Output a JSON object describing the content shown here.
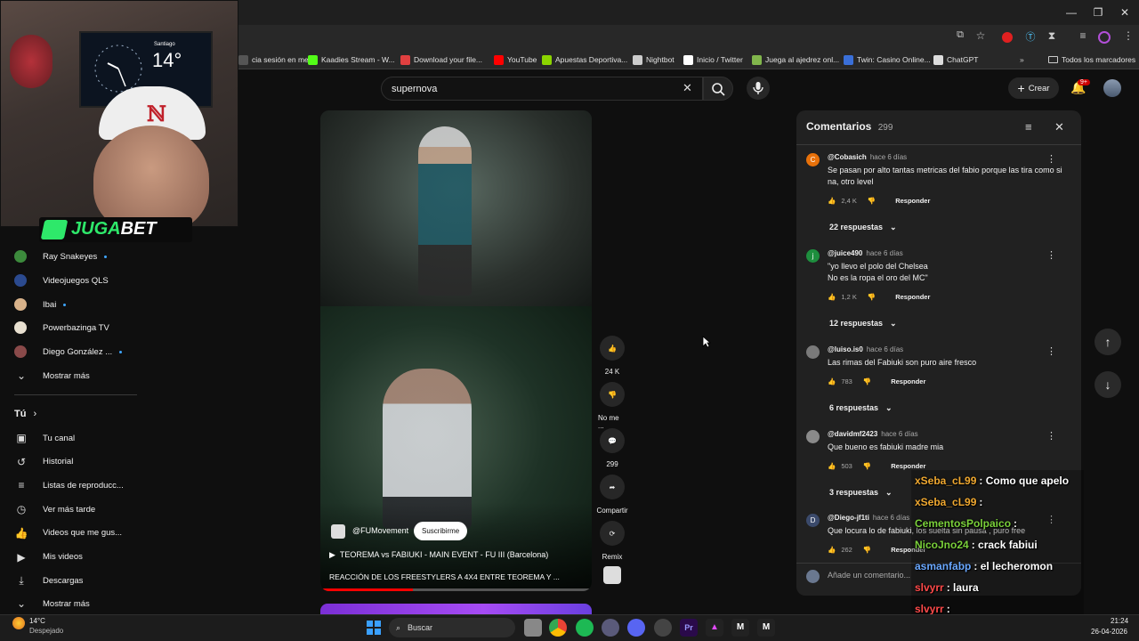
{
  "bookmarks": [
    {
      "label": "cia sesión en me...",
      "color": "#555555"
    },
    {
      "label": "Kaadies Stream - W...",
      "color": "#53fc18"
    },
    {
      "label": "Download your file...",
      "color": "#e04040"
    },
    {
      "label": "YouTube",
      "color": "#ff0000"
    },
    {
      "label": "Apuestas Deportiva...",
      "color": "#8bd400"
    },
    {
      "label": "Nightbot",
      "color": "#cccccc"
    },
    {
      "label": "Inicio / Twitter",
      "color": "#ffffff"
    },
    {
      "label": "Juega al ajedrez onl...",
      "color": "#81b64c"
    },
    {
      "label": "Twin: Casino Online...",
      "color": "#3a6fd8"
    },
    {
      "label": "ChatGPT",
      "color": "#dddddd"
    }
  ],
  "bookmarks_all": "Todos los marcadores",
  "bookmarks_more": "»",
  "search": {
    "value": "supernova"
  },
  "crear": "Crear",
  "notif_badge": "9+",
  "webcam": {
    "city": "Santiago",
    "temp": "14°"
  },
  "jugabet": {
    "juga": "JUGA",
    "bet": "BET"
  },
  "sidebar": {
    "channels": [
      {
        "label": "Ray Snakeyes",
        "color": "#3c8a3c",
        "dot": true
      },
      {
        "label": "Videojuegos QLS",
        "color": "#2b4a8f",
        "dot": false
      },
      {
        "label": "Ibai",
        "color": "#d8b28a",
        "dot": true
      },
      {
        "label": "Powerbazinga TV",
        "color": "#e8e0d0",
        "dot": false
      },
      {
        "label": "Diego González ...",
        "color": "#8a4a4a",
        "dot": true
      }
    ],
    "show_more": "Mostrar más",
    "tu_header": "Tú",
    "tu_items": [
      {
        "label": "Tu canal",
        "icon": "channel-icon",
        "glyph": "▣"
      },
      {
        "label": "Historial",
        "icon": "history-icon",
        "glyph": "↺"
      },
      {
        "label": "Listas de reproducc...",
        "icon": "playlists-icon",
        "glyph": "≡"
      },
      {
        "label": "Ver más tarde",
        "icon": "clock-icon",
        "glyph": "◷"
      },
      {
        "label": "Videos que me gus...",
        "icon": "like-icon",
        "glyph": "👍"
      },
      {
        "label": "Mis videos",
        "icon": "my-videos-icon",
        "glyph": "▶"
      },
      {
        "label": "Descargas",
        "icon": "download-icon",
        "glyph": "⤓"
      }
    ],
    "show_more_2": "Mostrar más"
  },
  "video": {
    "channel": "@FUMovement",
    "subscribe": "Suscribirme",
    "related_title": "TEOREMA vs FABIUKI - MAIN EVENT - FU III (Barcelona)",
    "title": "REACCIÓN DE LOS FREESTYLERS A 4X4 ENTRE TEOREMA Y ...",
    "progress": 0.34
  },
  "actions": {
    "likes": "24 K",
    "dislike": "No me ...",
    "comments": "299",
    "share": "Compartir",
    "remix": "Remix"
  },
  "comments": {
    "title": "Comentarios",
    "count": "299",
    "placeholder": "Añade un comentario...",
    "items": [
      {
        "author": "@Cobasich",
        "time": "hace 6 días",
        "text": "Se pasan por alto tantas metricas del fabio porque las tira como si na, otro level",
        "likes": "2,4 K",
        "reply": "Responder",
        "replies": "22 respuestas",
        "avatar_letter": "C",
        "avatar_color": "#e8710a"
      },
      {
        "author": "@juice490",
        "time": "hace 6 días",
        "text": "\"yo llevo el polo del Chelsea\nNo es la ropa el oro del MC\"",
        "likes": "1,2 K",
        "reply": "Responder",
        "replies": "12 respuestas",
        "avatar_letter": "j",
        "avatar_color": "#1e8e3e"
      },
      {
        "author": "@luiso.is0",
        "time": "hace 6 días",
        "text": "Las rimas del Fabiuki son puro aire fresco",
        "likes": "783",
        "reply": "Responder",
        "replies": "6 respuestas",
        "avatar_letter": "",
        "avatar_color": "#7a7a7a"
      },
      {
        "author": "@davidmf2423",
        "time": "hace 6 días",
        "text": "Que bueno es fabiuki madre mia",
        "likes": "503",
        "reply": "Responder",
        "replies": "3 respuestas",
        "avatar_letter": "",
        "avatar_color": "#8a8a8a"
      },
      {
        "author": "@Diego-jf1ti",
        "time": "hace 6 días",
        "text": "Que locura lo de fabiuki, los suelta sin pausa , puro free",
        "likes": "262",
        "reply": "Responder",
        "replies": "",
        "avatar_letter": "D",
        "avatar_color": "#3b4a6b"
      }
    ]
  },
  "chat": [
    {
      "user": "xSeba_cL99",
      "msg": ": Como que apelo",
      "color": "#f0a830"
    },
    {
      "user": "xSeba_cL99",
      "msg": ":",
      "color": "#f0a830"
    },
    {
      "user": "CementosPolpaico",
      "msg": ":",
      "color": "#7ad03a"
    },
    {
      "user": "NicoJno24",
      "msg": ": crack fabiui",
      "color": "#7ad03a"
    },
    {
      "user": "asmanfabp",
      "msg": ": el lecheromon",
      "color": "#6aa8ff"
    },
    {
      "user": "slvyrr",
      "msg": ": laura",
      "color": "#ff4a4a"
    },
    {
      "user": "slvyrr",
      "msg": ":",
      "color": "#ff4a4a"
    },
    {
      "user": "slvyrr",
      "msg": ":",
      "color": "#ff4a4a"
    }
  ],
  "taskbar": {
    "weather_temp": "14°C",
    "weather_desc": "Despejado",
    "search": "Buscar",
    "time": "21:24",
    "date": "26-04-2026"
  }
}
